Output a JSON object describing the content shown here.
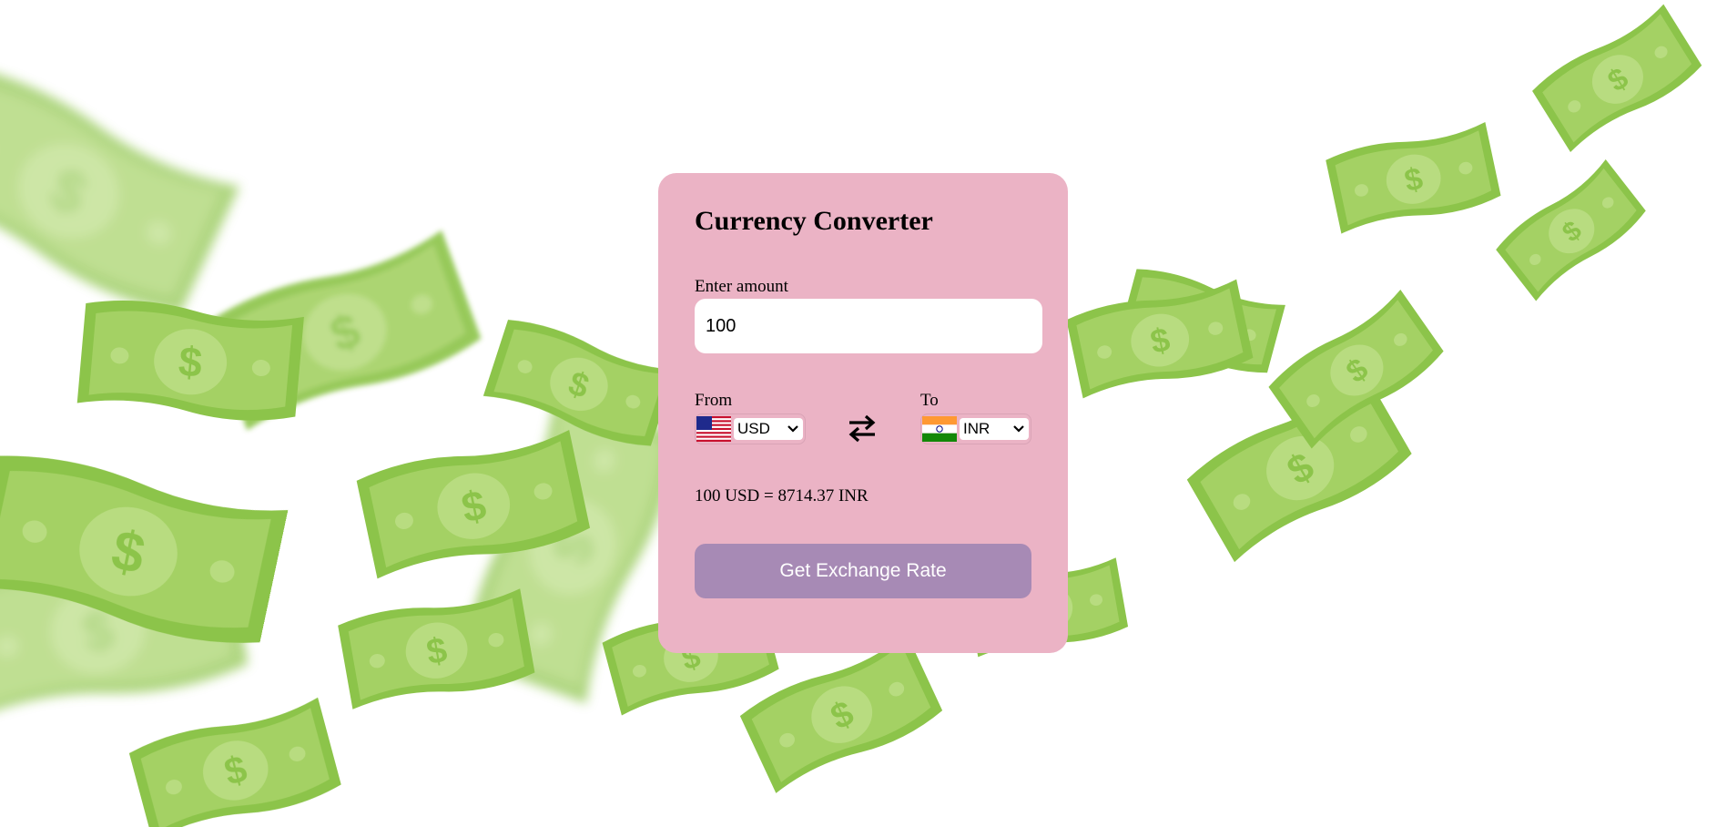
{
  "card": {
    "title": "Currency Converter",
    "amount_label": "Enter amount",
    "amount_value": "100",
    "from_label": "From",
    "to_label": "To",
    "from_currency": "USD",
    "to_currency": "INR",
    "result_text": "100 USD = 8714.37 INR",
    "button_label": "Get Exchange Rate"
  },
  "icons": {
    "from_flag": "us-flag-icon",
    "to_flag": "india-flag-icon",
    "swap": "swap-arrows-icon"
  },
  "colors": {
    "card_bg": "#ebb3c5",
    "button_bg": "#a78ab5",
    "bill_green": "#8bc34a"
  }
}
